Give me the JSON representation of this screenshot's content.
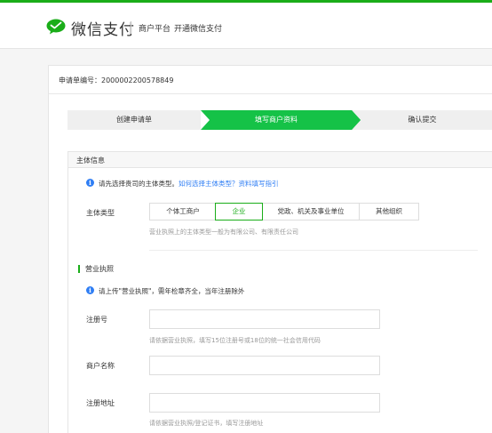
{
  "header": {
    "brand": "微信支付",
    "merchant_platform": "商户平台",
    "open_pay": "开通微信支付"
  },
  "application": {
    "number_text": "申请单编号：2000002200578849"
  },
  "steps": [
    {
      "label": "创建申请单",
      "state": "done"
    },
    {
      "label": "填写商户资料",
      "state": "current"
    },
    {
      "label": "确认提交",
      "state": "todo"
    }
  ],
  "subject": {
    "section_title": "主体信息",
    "tip_text": "请先选择贵司的主体类型。",
    "tip_link1": "如何选择主体类型？",
    "tip_link2": "资料填写指引",
    "type_label": "主体类型",
    "types": [
      "个体工商户",
      "企业",
      "党政、机关及事业单位",
      "其他组织"
    ],
    "selected_type": "企业",
    "type_hint": "营业执照上的主体类型一般为有限公司、有限责任公司"
  },
  "license": {
    "title": "营业执照",
    "tip_text": "请上传\"营业执照\"，需年检章齐全，当年注册除外",
    "reg_no_label": "注册号",
    "reg_no_value": "",
    "reg_no_hint": "请依据营业执照，填写15位注册号或18位的统一社会信用代码",
    "merchant_name_label": "商户名称",
    "merchant_name_value": "",
    "address_label": "注册地址",
    "address_value": "",
    "address_hint": "请依据营业执照/登记证书，填写注册地址"
  },
  "colors": {
    "brand_green": "#1aad19",
    "link_blue": "#2f7ef4",
    "step_green": "#15c247"
  },
  "icons": {
    "logo": "wechat-pay-logo-icon",
    "info": "info-icon"
  }
}
